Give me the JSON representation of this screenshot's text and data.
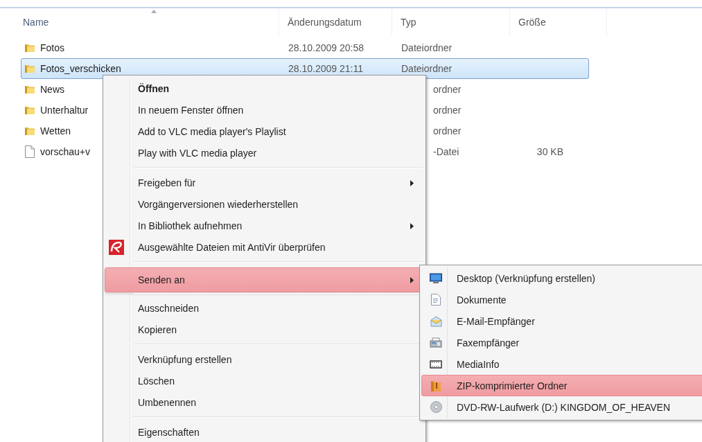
{
  "file_list": {
    "columns": [
      {
        "label": "Name",
        "sorted": true
      },
      {
        "label": "Änderungsdatum",
        "sorted": false
      },
      {
        "label": "Typ",
        "sorted": false
      },
      {
        "label": "Größe",
        "sorted": false
      }
    ],
    "rows": [
      {
        "kind": "folder",
        "name": "Fotos",
        "date": "28.10.2009 20:58",
        "type": "Dateiordner",
        "type_covered": false,
        "selected": false
      },
      {
        "kind": "folder",
        "name": "Fotos_verschicken",
        "date": "28.10.2009 21:11",
        "type": "Dateiordner",
        "type_covered": false,
        "selected": true
      },
      {
        "kind": "folder",
        "name": "News",
        "type": "ordner",
        "type_covered": true,
        "selected": false
      },
      {
        "kind": "folder",
        "name": "Unterhaltur",
        "type": "ordner",
        "type_covered": true,
        "selected": false
      },
      {
        "kind": "folder",
        "name": "Wetten",
        "type": "ordner",
        "type_covered": true,
        "selected": false
      },
      {
        "kind": "file",
        "name": "vorschau+v",
        "type": "-Datei",
        "type_covered": true,
        "size": "30 KB",
        "selected": false
      }
    ]
  },
  "context_menu": {
    "items": [
      {
        "kind": "item",
        "label": "Öffnen",
        "bold": true,
        "submenu": false,
        "has_icon": false,
        "selected": false
      },
      {
        "kind": "item",
        "label": "In neuem Fenster öffnen",
        "bold": false,
        "submenu": false,
        "has_icon": false,
        "selected": false
      },
      {
        "kind": "item",
        "label": "Add to VLC media player's Playlist",
        "bold": false,
        "submenu": false,
        "has_icon": false,
        "selected": false
      },
      {
        "kind": "item",
        "label": "Play with VLC media player",
        "bold": false,
        "submenu": false,
        "has_icon": false,
        "selected": false
      },
      {
        "kind": "separator"
      },
      {
        "kind": "item",
        "label": "Freigeben für",
        "bold": false,
        "submenu": true,
        "has_icon": false,
        "selected": false
      },
      {
        "kind": "item",
        "label": "Vorgängerversionen wiederherstellen",
        "bold": false,
        "submenu": false,
        "has_icon": false,
        "selected": false
      },
      {
        "kind": "item",
        "label": "In Bibliothek aufnehmen",
        "bold": false,
        "submenu": true,
        "has_icon": false,
        "selected": false
      },
      {
        "kind": "item",
        "label": "Ausgewählte Dateien mit AntiVir überprüfen",
        "bold": false,
        "submenu": false,
        "has_icon": true,
        "selected": false
      },
      {
        "kind": "separator"
      },
      {
        "kind": "item",
        "label": "Senden an",
        "bold": false,
        "submenu": true,
        "has_icon": false,
        "selected": true
      },
      {
        "kind": "separator"
      },
      {
        "kind": "item",
        "label": "Ausschneiden",
        "bold": false,
        "submenu": false,
        "has_icon": false,
        "selected": false
      },
      {
        "kind": "item",
        "label": "Kopieren",
        "bold": false,
        "submenu": false,
        "has_icon": false,
        "selected": false
      },
      {
        "kind": "separator"
      },
      {
        "kind": "item",
        "label": "Verknüpfung erstellen",
        "bold": false,
        "submenu": false,
        "has_icon": false,
        "selected": false
      },
      {
        "kind": "item",
        "label": "Löschen",
        "bold": false,
        "submenu": false,
        "has_icon": false,
        "selected": false
      },
      {
        "kind": "item",
        "label": "Umbenennen",
        "bold": false,
        "submenu": false,
        "has_icon": false,
        "selected": false
      },
      {
        "kind": "separator"
      },
      {
        "kind": "item",
        "label": "Eigenschaften",
        "bold": false,
        "submenu": false,
        "has_icon": false,
        "selected": false
      }
    ]
  },
  "send_to_menu": {
    "items": [
      {
        "label": "Desktop (Verknüpfung erstellen)",
        "selected": false
      },
      {
        "label": "Dokumente",
        "selected": false
      },
      {
        "label": "E-Mail-Empfänger",
        "selected": false
      },
      {
        "label": "Faxempfänger",
        "selected": false
      },
      {
        "label": "MediaInfo",
        "selected": false
      },
      {
        "label": "ZIP-komprimierter Ordner",
        "selected": true
      },
      {
        "label": "DVD-RW-Laufwerk (D:) KINGDOM_OF_HEAVEN",
        "selected": false
      }
    ]
  }
}
